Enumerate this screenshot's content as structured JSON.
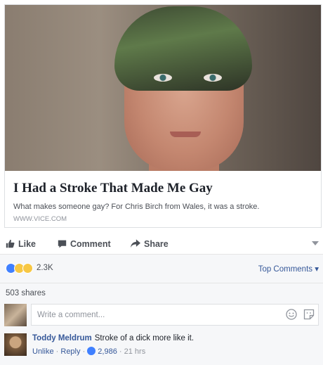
{
  "preview": {
    "headline": "I Had a Stroke That Made Me Gay",
    "description": "What makes someone gay? For Chris Birch from Wales, it was a stroke.",
    "domain": "WWW.VICE.COM"
  },
  "actions": {
    "like": "Like",
    "comment": "Comment",
    "share": "Share"
  },
  "reactions": {
    "count": "2.3K",
    "top_comments": "Top Comments"
  },
  "shares": "503 shares",
  "composer": {
    "placeholder": "Write a comment..."
  },
  "comment": {
    "author": "Toddy Meldrum",
    "text": "Stroke of a dick more like it.",
    "unlike": "Unlike",
    "reply": "Reply",
    "likes": "2,986",
    "time": "21 hrs"
  },
  "colors": {
    "link": "#365899",
    "like_blue": "#4080ff",
    "panel": "#f6f7f9"
  }
}
